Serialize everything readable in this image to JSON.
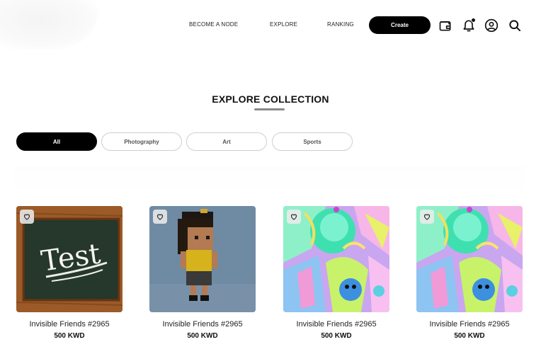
{
  "header": {
    "nav": [
      "BECOME A NODE",
      "EXPLORE",
      "RANKING"
    ],
    "create_label": "Create",
    "icons": [
      "wallet-icon",
      "bell-icon",
      "user-icon",
      "search-icon"
    ]
  },
  "section": {
    "title": "EXPLORE COLLECTION"
  },
  "filters": [
    "All",
    "Photography",
    "Art",
    "Sports"
  ],
  "active_filter": "All",
  "cards": [
    {
      "name": "Invisible Friends #2965",
      "price": "500 KWD",
      "image": "chalkboard-test"
    },
    {
      "name": "Invisible Friends #2965",
      "price": "500 KWD",
      "image": "voxel-character"
    },
    {
      "name": "Invisible Friends #2965",
      "price": "500 KWD",
      "image": "psychedelic-art"
    },
    {
      "name": "Invisible Friends #2965",
      "price": "500 KWD",
      "image": "psychedelic-art"
    }
  ],
  "colors": {
    "accent": "#000000",
    "underline": "#8a8a8a"
  }
}
